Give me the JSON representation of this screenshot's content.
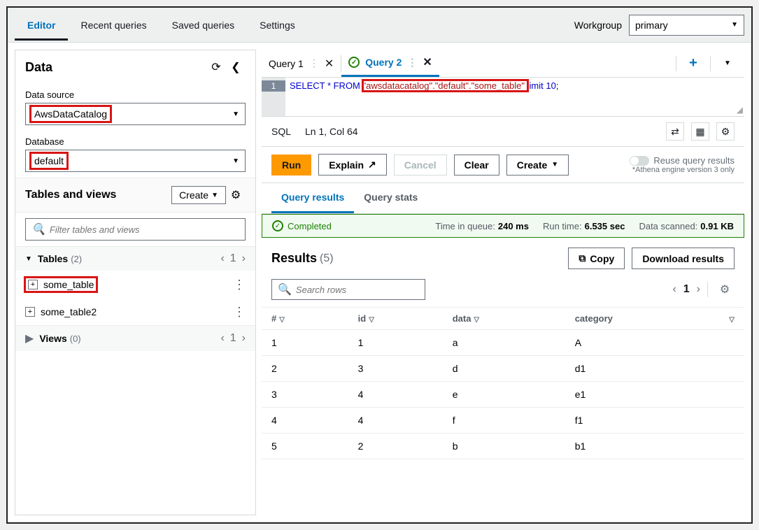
{
  "topnav": {
    "tabs": [
      "Editor",
      "Recent queries",
      "Saved queries",
      "Settings"
    ],
    "workgroup_label": "Workgroup",
    "workgroup_value": "primary"
  },
  "sidebar": {
    "title": "Data",
    "datasource_label": "Data source",
    "datasource_value": "AwsDataCatalog",
    "database_label": "Database",
    "database_value": "default",
    "tv_title": "Tables and views",
    "create_label": "Create",
    "filter_placeholder": "Filter tables and views",
    "tables_label": "Tables",
    "tables_count": "(2)",
    "tables_page": "1",
    "tables": [
      {
        "name": "some_table",
        "highlighted": true
      },
      {
        "name": "some_table2",
        "highlighted": false
      }
    ],
    "views_label": "Views",
    "views_count": "(0)",
    "views_page": "1"
  },
  "editor": {
    "tabs": [
      {
        "label": "Query 1",
        "active": false,
        "saved": true
      },
      {
        "label": "Query 2",
        "active": true,
        "saved": true
      }
    ],
    "sql_prefix": "SELECT * FROM ",
    "sql_mid": "\"awsdatacatalog\".\"default\".\"some_table\" ",
    "sql_suffix": "limit 10",
    "status_lang": "SQL",
    "status_pos": "Ln 1, Col 64",
    "actions": {
      "run": "Run",
      "explain": "Explain",
      "cancel": "Cancel",
      "clear": "Clear",
      "create": "Create"
    },
    "reuse_label": "Reuse query results",
    "reuse_note": "*Athena engine version 3 only"
  },
  "results": {
    "tab_results": "Query results",
    "tab_stats": "Query stats",
    "status": "Completed",
    "metrics": {
      "queue_label": "Time in queue:",
      "queue_val": "240 ms",
      "runtime_label": "Run time:",
      "runtime_val": "6.535 sec",
      "scanned_label": "Data scanned:",
      "scanned_val": "0.91 KB"
    },
    "title": "Results",
    "count": "(5)",
    "copy_label": "Copy",
    "download_label": "Download results",
    "search_placeholder": "Search rows",
    "page": "1",
    "columns": [
      "#",
      "id",
      "data",
      "category"
    ],
    "rows": [
      {
        "n": "1",
        "id": "1",
        "data": "a",
        "category": "A"
      },
      {
        "n": "2",
        "id": "3",
        "data": "d",
        "category": "d1"
      },
      {
        "n": "3",
        "id": "4",
        "data": "e",
        "category": "e1"
      },
      {
        "n": "4",
        "id": "4",
        "data": "f",
        "category": "f1"
      },
      {
        "n": "5",
        "id": "2",
        "data": "b",
        "category": "b1"
      }
    ]
  }
}
